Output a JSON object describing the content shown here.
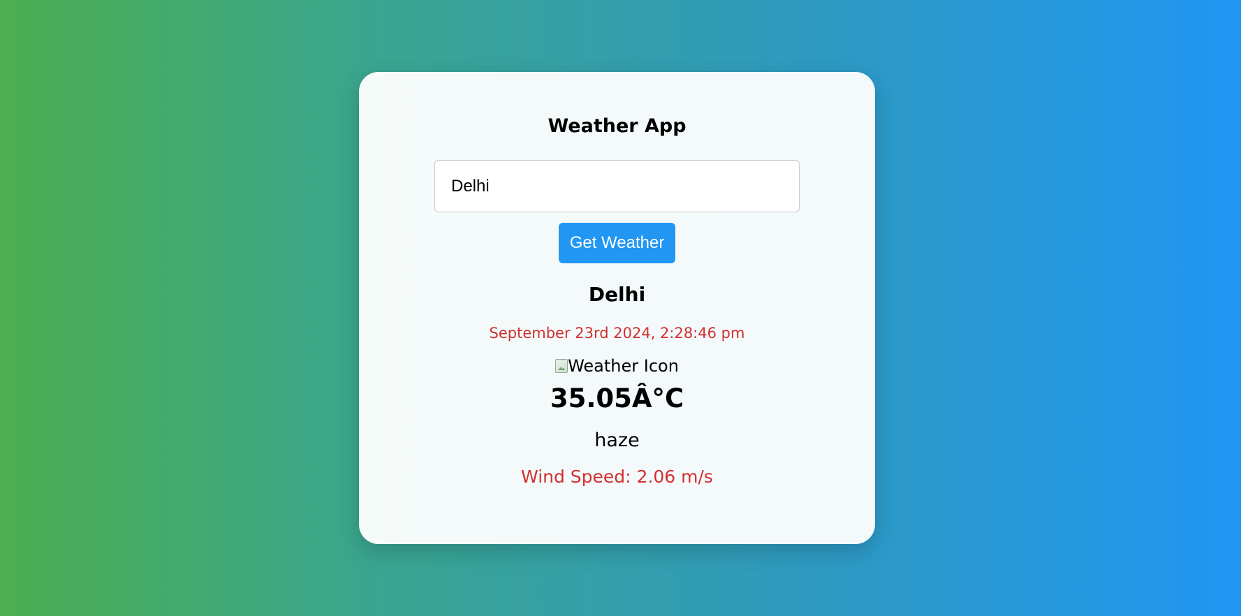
{
  "app": {
    "title": "Weather App"
  },
  "search": {
    "value": "Delhi"
  },
  "actions": {
    "get_weather_label": "Get Weather"
  },
  "weather": {
    "city": "Delhi",
    "datetime": "September 23rd 2024, 2:28:46 pm",
    "icon_alt": "Weather Icon",
    "temperature": "35.05Â°C",
    "description": "haze",
    "wind": "Wind Speed: 2.06 m/s"
  },
  "colors": {
    "gradient_start": "#4caf50",
    "gradient_end": "#2196f3",
    "button": "#2196f3",
    "accent_text": "#d32f2f"
  },
  "icons": {
    "weather": "broken-image-icon"
  }
}
